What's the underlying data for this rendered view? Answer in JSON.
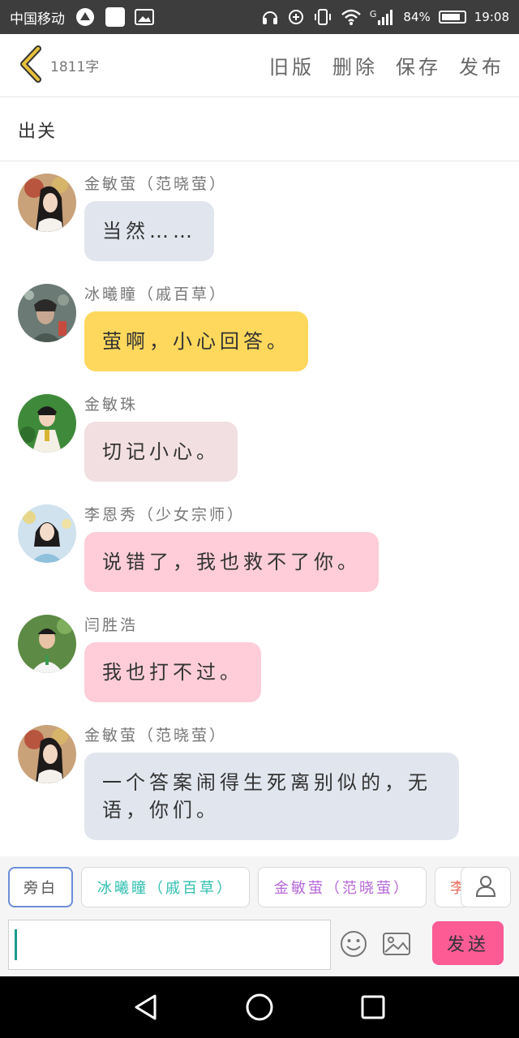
{
  "status_bar": {
    "carrier": "中国移动",
    "signal_tag": "G",
    "battery_percent": "84%",
    "time": "19:08"
  },
  "header": {
    "word_count": "1811字",
    "actions": [
      "旧版",
      "删除",
      "保存",
      "发布"
    ]
  },
  "title": "出关",
  "messages": [
    {
      "sender": "金敏萤（范晓萤）",
      "text": "当然……",
      "bubble_color": "#e1e6ee",
      "avatar_color": "#b8553f"
    },
    {
      "sender": "冰曦瞳（戚百草）",
      "text": "萤啊，小心回答。",
      "bubble_color": "#fed85d",
      "avatar_color": "#6b7a74"
    },
    {
      "sender": "金敏珠",
      "text": "切记小心。",
      "bubble_color": "#f1dfe1",
      "avatar_color": "#3f8a3a"
    },
    {
      "sender": "李恩秀（少女宗师）",
      "text": "说错了，我也救不了你。",
      "bubble_color": "#fecdd9",
      "avatar_color": "#9fc5df"
    },
    {
      "sender": "闫胜浩",
      "text": "我也打不过。",
      "bubble_color": "#fecdd9",
      "avatar_color": "#4f7a3a"
    },
    {
      "sender": "金敏萤（范晓萤）",
      "text": "一个答案闹得生死离别似的，无语，你们。",
      "bubble_color": "#e1e6ee",
      "avatar_color": "#b8553f"
    }
  ],
  "roles": [
    {
      "label": "旁白",
      "color": "#555555",
      "selected": true
    },
    {
      "label": "冰曦瞳（戚百草）",
      "color": "#2fbfb0",
      "selected": false
    },
    {
      "label": "金敏萤（范晓萤）",
      "color": "#b668d8",
      "selected": false
    },
    {
      "label": "李",
      "color": "#e96a5a",
      "selected": false
    }
  ],
  "composer": {
    "input_value": "",
    "send_label": "发送"
  },
  "icons": {
    "back": "chevron-left-icon",
    "user": "user-icon",
    "emoji": "emoji-icon",
    "image": "image-icon",
    "nav_back": "triangle-back-icon",
    "nav_home": "circle-home-icon",
    "nav_recent": "square-recent-icon"
  },
  "colors": {
    "accent_back": "#e8c13a",
    "send_button": "#fd5b94",
    "caret": "#1a9b8c"
  }
}
